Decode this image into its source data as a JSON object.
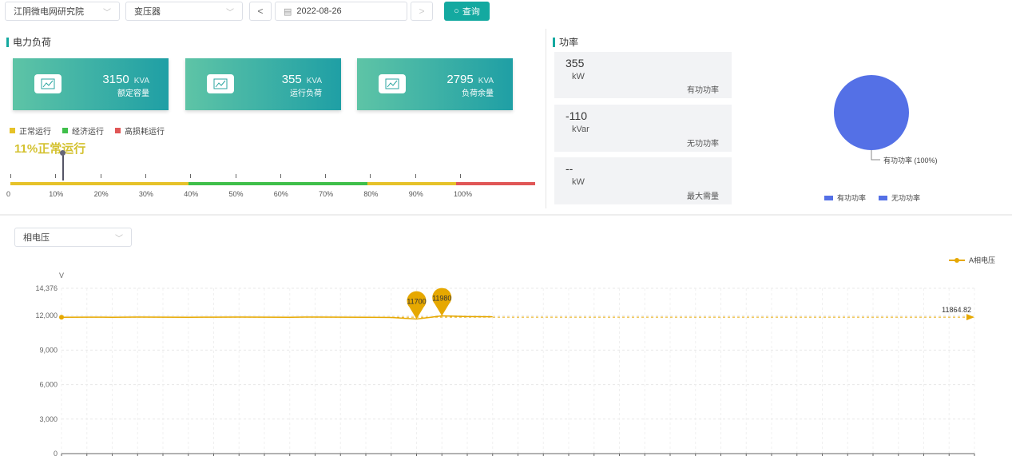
{
  "toolbar": {
    "org": "江阴微电网研究院",
    "device": "变压器",
    "prev": "<",
    "date": "2022-08-26",
    "next": ">",
    "query": "查询"
  },
  "load": {
    "title": "电力负荷",
    "cards": [
      {
        "value": "3150",
        "unit": "KVA",
        "label": "额定容量"
      },
      {
        "value": "355",
        "unit": "KVA",
        "label": "运行负荷"
      },
      {
        "value": "2795",
        "unit": "KVA",
        "label": "负荷余量"
      }
    ],
    "legend": [
      {
        "label": "正常运行",
        "color": "#e6c229"
      },
      {
        "label": "经济运行",
        "color": "#3fbf4a"
      },
      {
        "label": "高损耗运行",
        "color": "#e05656"
      }
    ],
    "status": "11%正常运行",
    "percent": 11,
    "ticks": [
      "0",
      "10%",
      "20%",
      "30%",
      "40%",
      "50%",
      "60%",
      "70%",
      "80%",
      "90%",
      "100%"
    ]
  },
  "power": {
    "title": "功率",
    "boxes": [
      {
        "value": "355",
        "unit": "kW",
        "label": "有功功率"
      },
      {
        "value": "-110",
        "unit": "kVar",
        "label": "无功功率"
      },
      {
        "value": "--",
        "unit": "kW",
        "label": "最大需量"
      }
    ],
    "pie": {
      "slice_label": "有功功率 (100%)",
      "legend": [
        {
          "label": "有功功率",
          "color": "#5470e6"
        },
        {
          "label": "无功功率",
          "color": "#5470e6"
        }
      ],
      "values": [
        100,
        0
      ]
    }
  },
  "voltage": {
    "selector": "相电压",
    "chart_data": {
      "type": "line",
      "ylabel": "V",
      "ylim": [
        0,
        14376
      ],
      "yticks": [
        "0",
        "3,000",
        "6,000",
        "9,000",
        "12,000",
        "14,376"
      ],
      "series": [
        {
          "name": "A相电压",
          "color": "#e6a800",
          "values": [
            11860,
            11870,
            11860,
            11880,
            11870,
            11860,
            11870,
            11880,
            11870,
            11860,
            11880,
            11870,
            11860,
            11840,
            11700,
            11980,
            11920,
            11900
          ]
        }
      ],
      "num_categories": 36,
      "markpoints": [
        {
          "label": "11700",
          "index": 14,
          "value": 11700
        },
        {
          "label": "11980",
          "index": 15,
          "value": 11980
        }
      ],
      "markline": {
        "label": "11864.82",
        "value": 11864.82
      }
    }
  }
}
